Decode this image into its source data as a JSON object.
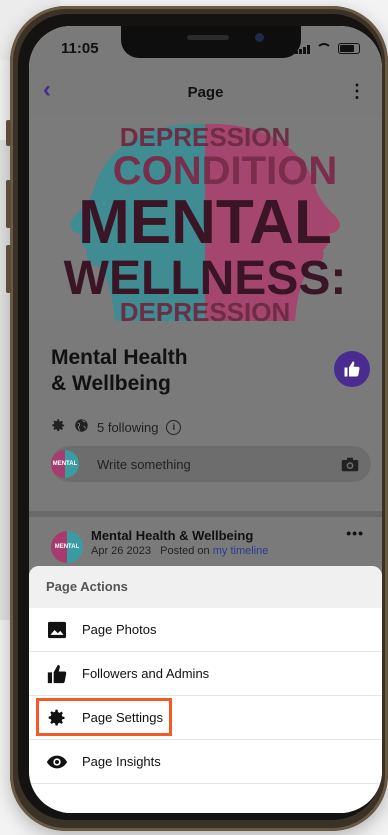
{
  "status_bar": {
    "time": "11:05"
  },
  "header": {
    "title": "Page"
  },
  "cover": {
    "words": {
      "top": "DEPRESSION",
      "middle": "CONDITION",
      "main": "MENTAL",
      "secondary": "WELLNESS:",
      "bottom": "DEPRESSION"
    }
  },
  "page": {
    "name": "Mental Health\n& Wellbeing",
    "following": "5 following"
  },
  "composer": {
    "placeholder": "Write something",
    "avatar_text": "MENTAL"
  },
  "post": {
    "author": "Mental Health & Wellbeing",
    "date": "Apr 26 2023",
    "posted_on": "Posted on",
    "location": "my timeline",
    "avatar_text": "MENTAL"
  },
  "sheet": {
    "title": "Page Actions",
    "actions": [
      {
        "label": "Page Photos",
        "icon": "image-icon"
      },
      {
        "label": "Followers and Admins",
        "icon": "thumbs-up-icon"
      },
      {
        "label": "Page Settings",
        "icon": "gear-icon",
        "highlighted": true
      },
      {
        "label": "Page Insights",
        "icon": "eye-icon"
      }
    ]
  },
  "colors": {
    "accent": "#4a2b8f",
    "highlight": "#f25b24",
    "overlay": "#7a7a7a"
  }
}
